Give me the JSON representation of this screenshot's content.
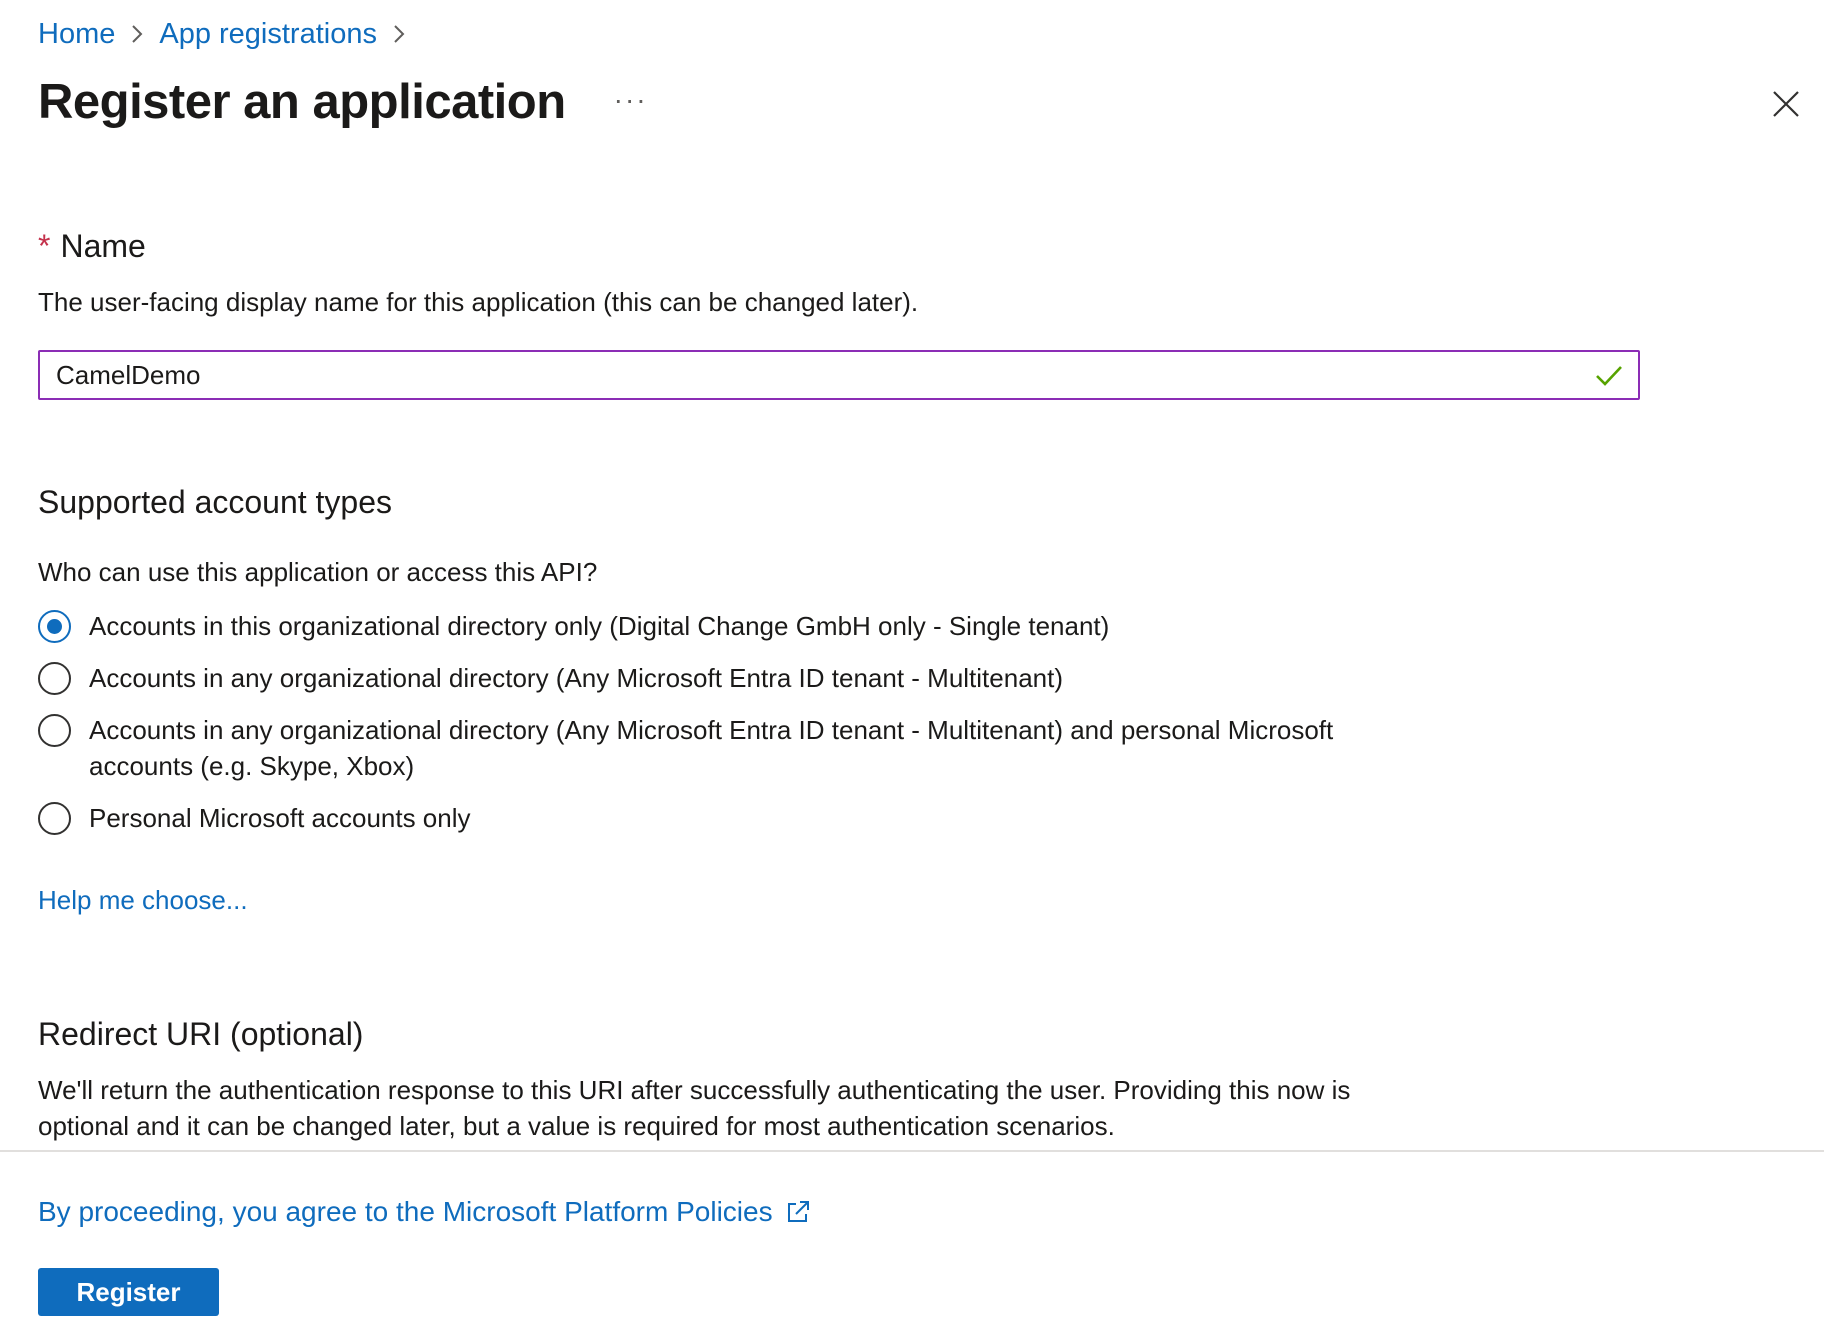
{
  "breadcrumb": {
    "items": [
      "Home",
      "App registrations"
    ]
  },
  "header": {
    "title": "Register an application",
    "more_label": "···"
  },
  "name_section": {
    "required_marker": "*",
    "label": "Name",
    "description": "The user-facing display name for this application (this can be changed later).",
    "value": "CamelDemo"
  },
  "account_types": {
    "heading": "Supported account types",
    "question": "Who can use this application or access this API?",
    "options": [
      {
        "label": "Accounts in this organizational directory only (Digital Change GmbH only - Single tenant)",
        "checked": true
      },
      {
        "label": "Accounts in any organizational directory (Any Microsoft Entra ID tenant - Multitenant)",
        "checked": false
      },
      {
        "label": "Accounts in any organizational directory (Any Microsoft Entra ID tenant - Multitenant) and personal Microsoft accounts (e.g. Skype, Xbox)",
        "checked": false
      },
      {
        "label": "Personal Microsoft accounts only",
        "checked": false
      }
    ],
    "help_link": "Help me choose..."
  },
  "redirect": {
    "heading": "Redirect URI (optional)",
    "description": "We'll return the authentication response to this URI after successfully authenticating the user. Providing this now is optional and it can be changed later, but a value is required for most authentication scenarios."
  },
  "footer": {
    "policy_link": "By proceeding, you agree to the Microsoft Platform Policies",
    "register_label": "Register"
  },
  "colors": {
    "link": "#0f6cbd",
    "input_border": "#8b2db5",
    "valid": "#57a300",
    "required": "#c4314b",
    "primary_button": "#0f6cbd"
  },
  "icons": [
    "chevron-right-icon",
    "more-icon",
    "close-icon",
    "checkmark-icon",
    "external-link-icon"
  ]
}
